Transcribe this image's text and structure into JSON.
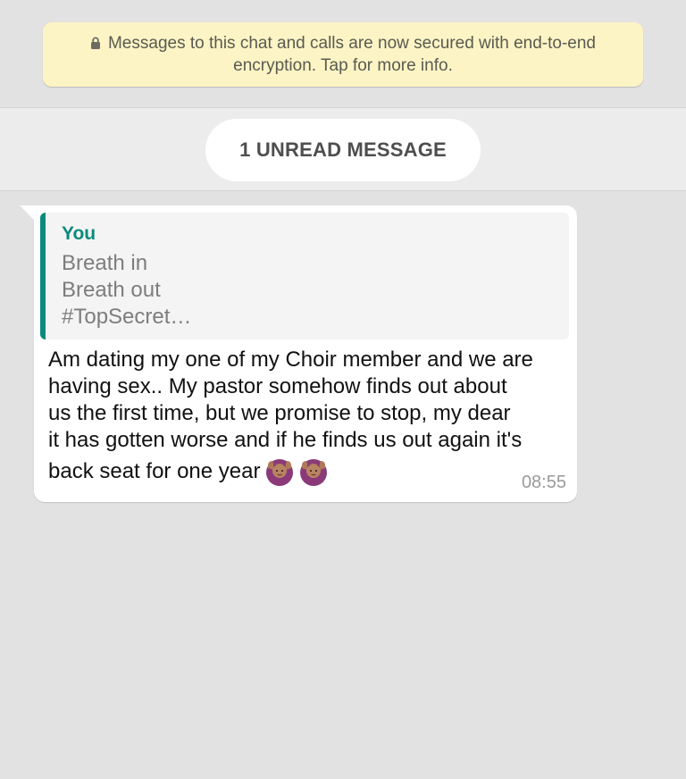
{
  "encryption_notice": {
    "line1": "Messages to this chat and calls are now secured with end-to-end",
    "line2": "encryption. Tap for more info.",
    "icon": "lock-icon"
  },
  "unread_divider": {
    "label": "1 UNREAD MESSAGE"
  },
  "message": {
    "quoted": {
      "author": "You",
      "text": "Breath in\nBreath out\n#TopSecret…"
    },
    "lines": [
      "Am dating my one of my Choir member and we are",
      "having sex.. My pastor somehow finds out about",
      "us the first time, but we promise to stop, my dear",
      "it has gotten worse and if he finds us out again it's"
    ],
    "last_line": "back seat for one year",
    "emojis": [
      "person-gesturing-ok-icon",
      "person-gesturing-ok-icon"
    ],
    "time": "08:55"
  },
  "colors": {
    "notice_bg": "#fcf4c4",
    "quote_accent": "#0b8a7c",
    "chat_bg": "#e2e2e2"
  }
}
